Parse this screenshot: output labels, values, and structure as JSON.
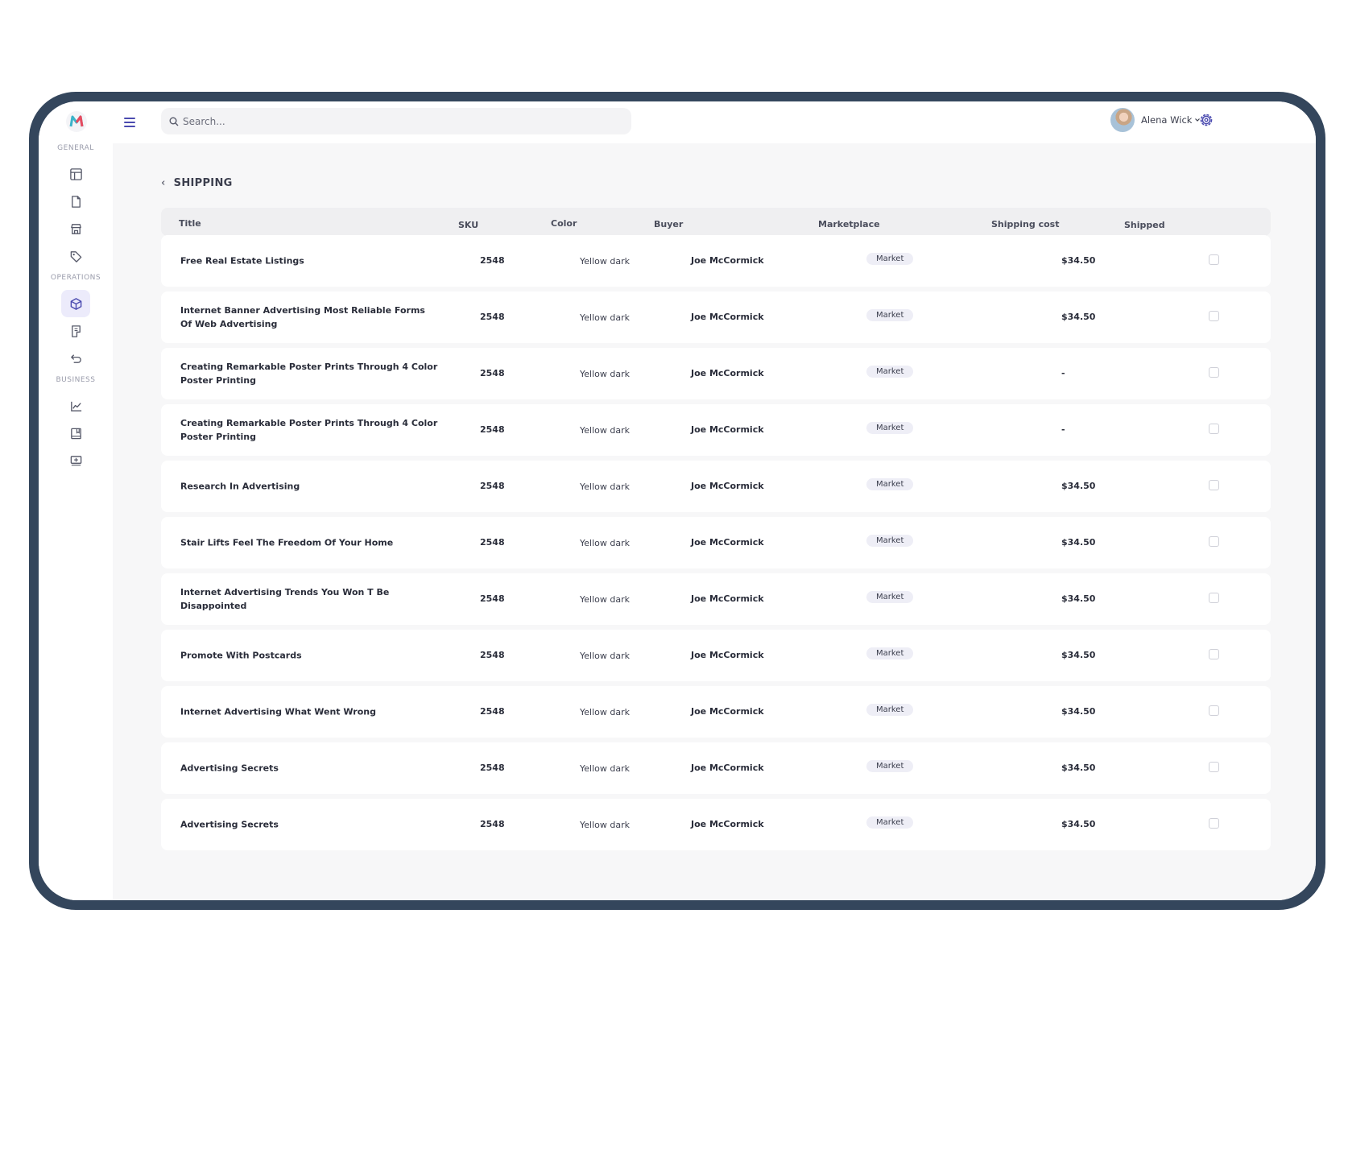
{
  "sidebar": {
    "sections": [
      {
        "label": "GENERAL",
        "items": [
          "layout-icon",
          "document-icon",
          "store-icon",
          "tag-icon"
        ]
      },
      {
        "label": "OPERATIONS",
        "items": [
          "box-icon",
          "invoice-icon",
          "return-icon"
        ]
      },
      {
        "label": "BUSINESS",
        "items": [
          "chart-icon",
          "book-icon",
          "monitor-icon"
        ]
      }
    ],
    "active_item": "box-icon"
  },
  "header": {
    "search_placeholder": "Search...",
    "user_name": "Alena Wick",
    "accent": "#4b4bb0"
  },
  "page": {
    "title": "SHIPPING"
  },
  "table": {
    "columns": [
      "Title",
      "SKU",
      "Color",
      "Buyer",
      "Marketplace",
      "Shipping cost",
      "Shipped"
    ],
    "rows": [
      {
        "title": "Free Real Estate Listings",
        "sku": "2548",
        "color": "Yellow dark",
        "buyer": "Joe McCormick",
        "marketplace": "Market",
        "cost": "$34.50",
        "shipped": false
      },
      {
        "title": "Internet Banner Advertising Most Reliable Forms Of Web Advertising",
        "sku": "2548",
        "color": "Yellow dark",
        "buyer": "Joe McCormick",
        "marketplace": "Market",
        "cost": "$34.50",
        "shipped": false
      },
      {
        "title": "Creating Remarkable Poster Prints Through 4 Color Poster Printing",
        "sku": "2548",
        "color": "Yellow dark",
        "buyer": "Joe McCormick",
        "marketplace": "Market",
        "cost": "-",
        "shipped": false
      },
      {
        "title": "Creating Remarkable Poster Prints Through 4 Color Poster Printing",
        "sku": "2548",
        "color": "Yellow dark",
        "buyer": "Joe McCormick",
        "marketplace": "Market",
        "cost": "-",
        "shipped": false
      },
      {
        "title": "Research In Advertising",
        "sku": "2548",
        "color": "Yellow dark",
        "buyer": "Joe McCormick",
        "marketplace": "Market",
        "cost": "$34.50",
        "shipped": false
      },
      {
        "title": "Stair Lifts Feel The Freedom Of Your Home",
        "sku": "2548",
        "color": "Yellow dark",
        "buyer": "Joe McCormick",
        "marketplace": "Market",
        "cost": "$34.50",
        "shipped": false
      },
      {
        "title": "Internet Advertising Trends You Won T Be Disappointed",
        "sku": "2548",
        "color": "Yellow dark",
        "buyer": "Joe McCormick",
        "marketplace": "Market",
        "cost": "$34.50",
        "shipped": false
      },
      {
        "title": "Promote With Postcards",
        "sku": "2548",
        "color": "Yellow dark",
        "buyer": "Joe McCormick",
        "marketplace": "Market",
        "cost": "$34.50",
        "shipped": false
      },
      {
        "title": "Internet Advertising What Went Wrong",
        "sku": "2548",
        "color": "Yellow dark",
        "buyer": "Joe McCormick",
        "marketplace": "Market",
        "cost": "$34.50",
        "shipped": false
      },
      {
        "title": "Advertising Secrets",
        "sku": "2548",
        "color": "Yellow dark",
        "buyer": "Joe McCormick",
        "marketplace": "Market",
        "cost": "$34.50",
        "shipped": false
      },
      {
        "title": "Advertising Secrets",
        "sku": "2548",
        "color": "Yellow dark",
        "buyer": "Joe McCormick",
        "marketplace": "Market",
        "cost": "$34.50",
        "shipped": false
      }
    ]
  }
}
